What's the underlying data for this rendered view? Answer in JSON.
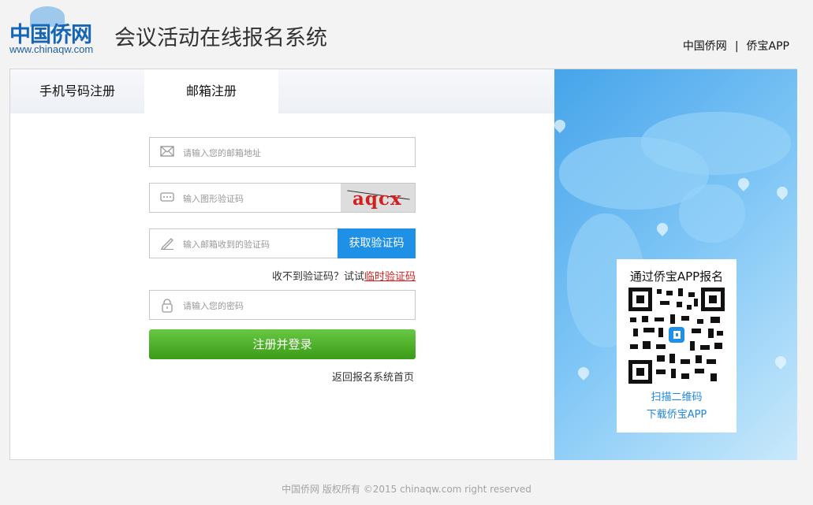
{
  "header": {
    "logo_text": "中国侨网",
    "logo_url": "www.chinaqw.com",
    "site_title": "会议活动在线报名系统",
    "links": [
      "中国侨网",
      "侨宝APP"
    ],
    "separator": "|"
  },
  "tabs": [
    {
      "label": "手机号码注册",
      "active": false
    },
    {
      "label": "邮箱注册",
      "active": true
    }
  ],
  "form": {
    "email_placeholder": "请输入您的邮箱地址",
    "captcha_placeholder": "输入图形验证码",
    "captcha_text": "aqcx",
    "email_code_placeholder": "输入邮箱收到的验证码",
    "get_code_label": "获取验证码",
    "hint_text": "收不到验证码？试试",
    "hint_link": "临时验证码",
    "password_placeholder": "请输入您的密码",
    "submit_label": "注册并登录",
    "back_link": "返回报名系统首页"
  },
  "side_panel": {
    "qr_title": "通过侨宝APP报名",
    "qr_line1": "扫描二维码",
    "qr_line2": "下载侨宝APP"
  },
  "footer": {
    "copyright": "中国侨网 版权所有 ©2015 chinaqw.com right reserved"
  },
  "colors": {
    "primary_blue": "#1e90e6",
    "submit_green": "#4caf24",
    "link_red": "#d21f1f",
    "side_blue": "#46a4ea"
  },
  "icons": {
    "email": "envelope-icon",
    "captcha": "dots-icon",
    "email_code": "pencil-icon",
    "password": "lock-icon"
  }
}
